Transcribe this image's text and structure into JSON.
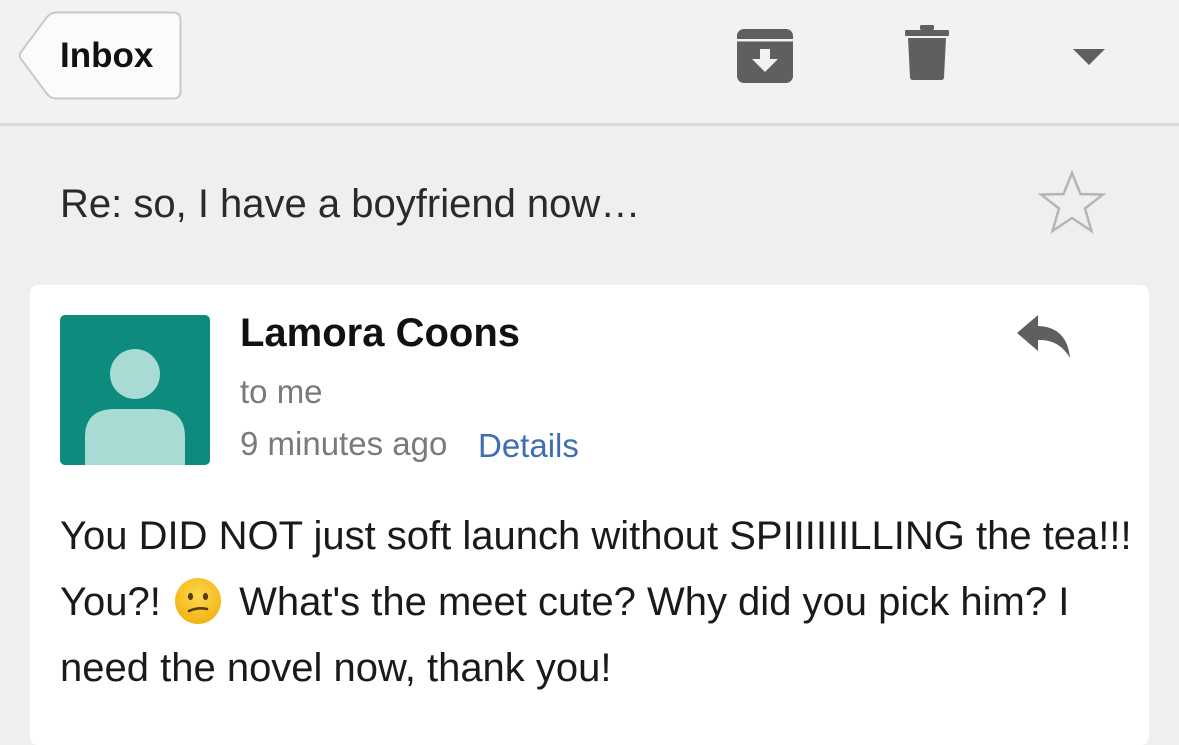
{
  "nav": {
    "back_label": "Inbox"
  },
  "toolbar": {
    "archive_icon": "archive-icon",
    "delete_icon": "trash-icon",
    "more_icon": "chevron-down-icon"
  },
  "thread": {
    "subject": "Re: so, I have a boyfriend now…",
    "starred": false
  },
  "message": {
    "sender": "Lamora Coons",
    "recipient": "to me",
    "time": "9 minutes ago",
    "details_label": "Details",
    "body_before_emoji": "You DID NOT just soft launch without SPIIIIIILLING the tea!!! You?!",
    "emoji": "confused-face",
    "body_after_emoji": "What's the meet cute? Why did you pick him? I need the novel now, thank you!"
  },
  "colors": {
    "accent_link": "#3f6fb0",
    "avatar_bg": "#0d8b7d",
    "avatar_fg": "#a9dbd5"
  }
}
